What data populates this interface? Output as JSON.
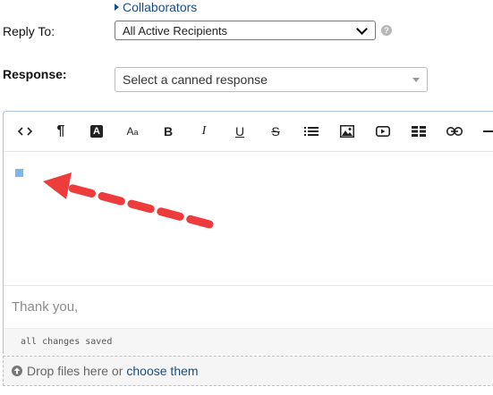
{
  "collaborators": {
    "label": "Collaborators"
  },
  "reply_to": {
    "label": "Reply To:",
    "selected": "All Active Recipients",
    "help_icon": "help-icon"
  },
  "response": {
    "label": "Response:",
    "placeholder": "Select a canned response"
  },
  "toolbar": [
    {
      "name": "code-view-button",
      "glyph": "<>"
    },
    {
      "name": "paragraph-format-button",
      "glyph": "¶"
    },
    {
      "name": "text-color-button",
      "glyph": "A"
    },
    {
      "name": "font-size-button",
      "glyph": "Aa"
    },
    {
      "name": "bold-button",
      "glyph": "B"
    },
    {
      "name": "italic-button",
      "glyph": "I"
    },
    {
      "name": "underline-button",
      "glyph": "U"
    },
    {
      "name": "strikethrough-button",
      "glyph": "S"
    },
    {
      "name": "unordered-list-button",
      "glyph": "list"
    },
    {
      "name": "insert-image-button",
      "glyph": "image"
    },
    {
      "name": "insert-video-button",
      "glyph": "video"
    },
    {
      "name": "insert-table-button",
      "glyph": "table"
    },
    {
      "name": "insert-link-button",
      "glyph": "link"
    },
    {
      "name": "horizontal-line-button",
      "glyph": "line"
    }
  ],
  "editor": {
    "signature": "Thank you,",
    "status": "all changes saved"
  },
  "dropzone": {
    "text": "Drop files here or",
    "link": "choose them"
  },
  "colors": {
    "link": "#184e81",
    "arrow": "#ee3b3b",
    "cursor": "#7ab8f2"
  }
}
